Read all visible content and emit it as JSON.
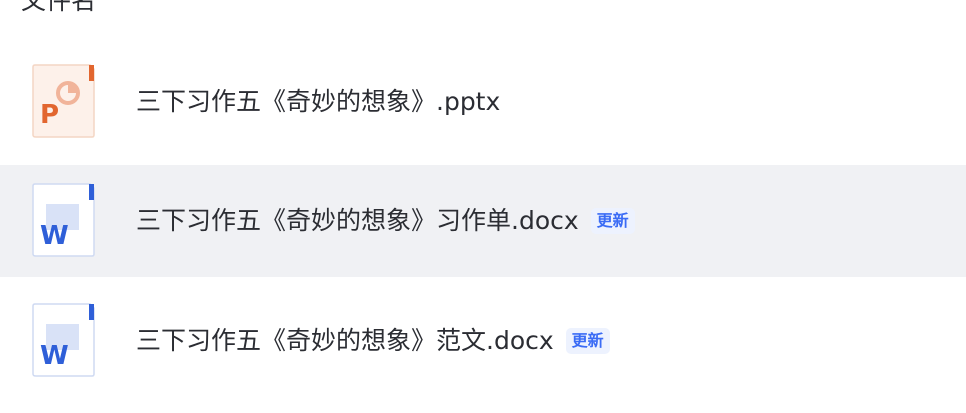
{
  "list": {
    "column_header": "文件名",
    "files": [
      {
        "name": "三下习作五《奇妙的想象》.pptx",
        "type": "pptx",
        "icon": "powerpoint-file-icon",
        "badge": "",
        "hovered": false
      },
      {
        "name": "三下习作五《奇妙的想象》习作单.docx",
        "type": "docx",
        "icon": "word-file-icon",
        "badge": "更新",
        "hovered": true
      },
      {
        "name": "三下习作五《奇妙的想象》范文.docx",
        "type": "docx",
        "icon": "word-file-icon",
        "badge": "更新",
        "hovered": false
      }
    ]
  },
  "colors": {
    "hover_background": "#f0f1f4",
    "badge_text": "#3b6cf5",
    "badge_background": "#edf2fe",
    "powerpoint_accent": "#e2662f",
    "word_accent": "#2f5fd8"
  }
}
